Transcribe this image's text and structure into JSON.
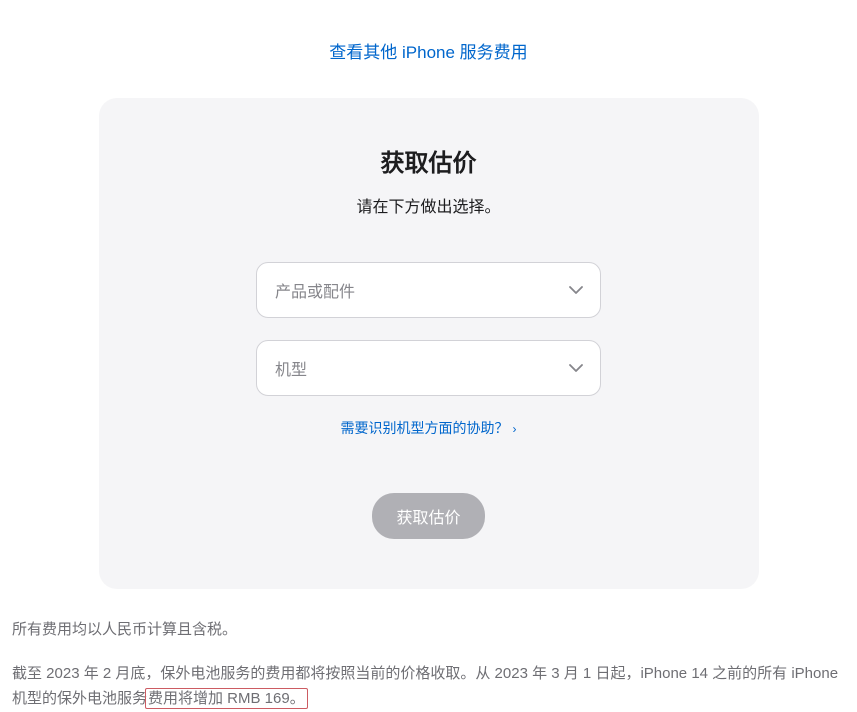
{
  "topLink": {
    "label": "查看其他 iPhone 服务费用"
  },
  "card": {
    "title": "获取估价",
    "subtitle": "请在下方做出选择。",
    "select1": {
      "placeholder": "产品或配件"
    },
    "select2": {
      "placeholder": "机型"
    },
    "helpLink": {
      "label": "需要识别机型方面的协助？"
    },
    "submitLabel": "获取估价"
  },
  "footnotes": {
    "line1": "所有费用均以人民币计算且含税。",
    "line2a": "截至 2023 年 2 月底，保外电池服务的费用都将按照当前的价格收取。从 2023 年 3 月 1 日起，iPhone 14 之前的所有 iPhone 机型的保外电池服务",
    "line2b": "费用将增加 RMB 169。"
  }
}
